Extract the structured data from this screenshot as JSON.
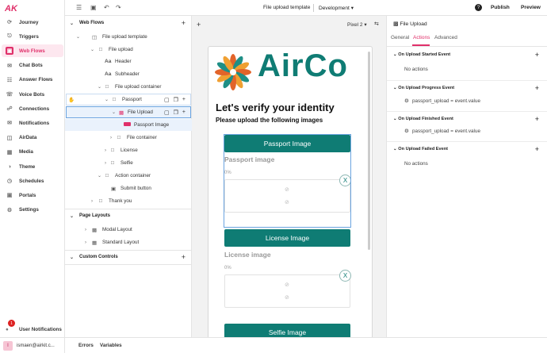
{
  "brand": {
    "logo": "AK",
    "accent": "#e0306a",
    "teal": "#0f7c74"
  },
  "nav": {
    "items": [
      {
        "label": "Journey",
        "icon": "journey-icon"
      },
      {
        "label": "Triggers",
        "icon": "triggers-icon"
      },
      {
        "label": "Web Flows",
        "icon": "web-flows-icon"
      },
      {
        "label": "Chat Bots",
        "icon": "chat-bots-icon"
      },
      {
        "label": "Answer Flows",
        "icon": "answer-flows-icon"
      },
      {
        "label": "Voice Bots",
        "icon": "voice-bots-icon"
      },
      {
        "label": "Connections",
        "icon": "connections-icon"
      },
      {
        "label": "Notifications",
        "icon": "notifications-icon"
      },
      {
        "label": "AirData",
        "icon": "airdata-icon"
      },
      {
        "label": "Media",
        "icon": "media-icon"
      },
      {
        "label": "Theme",
        "icon": "theme-icon"
      },
      {
        "label": "Schedules",
        "icon": "schedules-icon"
      },
      {
        "label": "Portals",
        "icon": "portals-icon"
      },
      {
        "label": "Settings",
        "icon": "settings-icon"
      }
    ],
    "active": "Web Flows",
    "user_notifications": "User Notifications",
    "notification_count": "1",
    "avatar_initial": "I",
    "user_email": "ismaen@airkit.c..."
  },
  "topbar": {
    "title": "File upload template",
    "environment": "Development",
    "help": "?",
    "publish": "Publish",
    "preview": "Preview"
  },
  "tree": {
    "web_flows_header": "Web Flows",
    "nodes": {
      "file_upload_template": "File upload template",
      "file_upload": "File upload",
      "header": "Header",
      "subheader": "Subheader",
      "file_upload_container": "File upload container",
      "passport": "Passport",
      "file_upload_selected": "File Upload",
      "passport_image": "Passport Image",
      "file_container": "File container",
      "license": "License",
      "selfie": "Selfie",
      "action_container": "Action container",
      "submit_button": "Submit button",
      "thank_you": "Thank you"
    },
    "text_icon": "Aa",
    "page_layouts_header": "Page Layouts",
    "modal_layout": "Modal Layout",
    "standard_layout": "Standard Layout",
    "custom_controls_header": "Custom Controls"
  },
  "canvas": {
    "device": "Pixel 2",
    "logo_text": "AirCo",
    "title": "Let's verify your identity",
    "subtitle": "Please upload the following images",
    "passport_button": "Passport Image",
    "passport_label": "Passport image",
    "passport_pct": "0%",
    "license_button": "License Image",
    "license_label": "License image",
    "license_pct": "0%",
    "selfie_button": "Selfie Image",
    "remove_label": "X"
  },
  "props": {
    "title": "File Upload",
    "tabs": [
      "General",
      "Actions",
      "Advanced"
    ],
    "active_tab": "Actions",
    "events": [
      {
        "name": "On Upload Started Event",
        "body": "No actions"
      },
      {
        "name": "On Upload Progress Event",
        "body": "passport_upload = event.value"
      },
      {
        "name": "On Upload Finished Event",
        "body": "passport_upload = event.value"
      },
      {
        "name": "On Upload Failed Event",
        "body": "No actions"
      }
    ]
  },
  "footer": {
    "errors": "Errors",
    "variables": "Variables"
  }
}
